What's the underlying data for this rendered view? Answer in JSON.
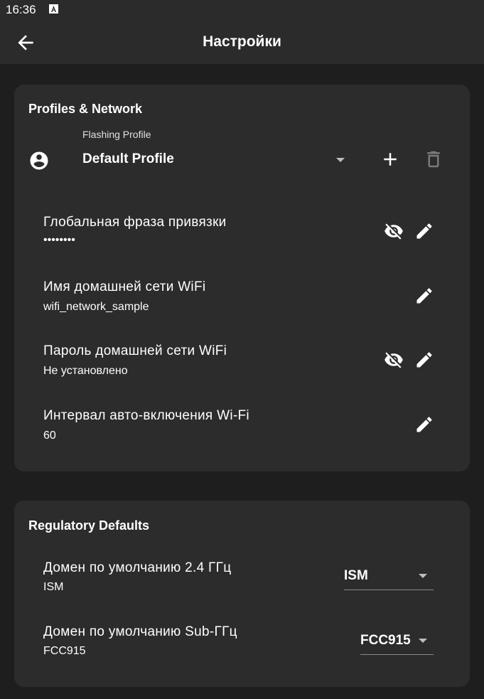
{
  "status_bar": {
    "time": "16:36",
    "notification_icon": "a-icon"
  },
  "app_bar": {
    "title": "Настройки",
    "back_icon": "arrow-left-icon"
  },
  "profiles_network": {
    "title": "Profiles & Network",
    "profile": {
      "label": "Flashing Profile",
      "value": "Default Profile"
    },
    "rows": [
      {
        "title": "Глобальная фраза привязки",
        "value": "••••••••"
      },
      {
        "title": "Имя домашней сети WiFi",
        "value": "wifi_network_sample"
      },
      {
        "title": "Пароль домашней сети WiFi",
        "value": "Не установлено"
      },
      {
        "title": "Интервал авто-включения Wi-Fi",
        "value": "60"
      }
    ]
  },
  "regulatory": {
    "title": "Regulatory Defaults",
    "rows": [
      {
        "title": "Домен по умолчанию 2.4 ГГц",
        "value": "ISM",
        "selected": "ISM"
      },
      {
        "title": "Домен по умолчанию Sub-ГГц",
        "value": "FCC915",
        "selected": "FCC915"
      }
    ]
  },
  "colors": {
    "background": "#1e1e1e",
    "bar": "#2b2b2b",
    "card": "#2c2c2c",
    "text": "#ffffff"
  }
}
